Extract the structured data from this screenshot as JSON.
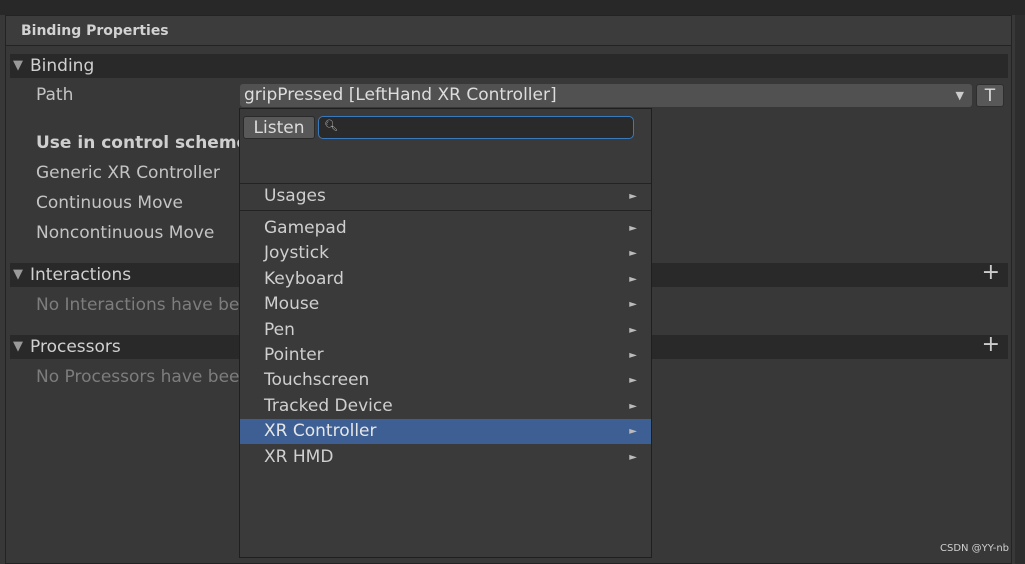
{
  "header": {
    "title": "Binding Properties"
  },
  "binding": {
    "title": "Binding",
    "path_label": "Path",
    "path_value": "gripPressed [LeftHand XR Controller]",
    "t_button": "T",
    "schemes_label": "Use in control scheme",
    "schemes": [
      "Generic XR Controller",
      "Continuous Move",
      "Noncontinuous Move"
    ]
  },
  "interactions": {
    "title": "Interactions",
    "empty": "No Interactions have been added."
  },
  "processors": {
    "title": "Processors",
    "empty": "No Processors have been added."
  },
  "popup": {
    "listen": "Listen",
    "search_value": "",
    "usages": "Usages",
    "items": [
      "Gamepad",
      "Joystick",
      "Keyboard",
      "Mouse",
      "Pen",
      "Pointer",
      "Touchscreen",
      "Tracked Device",
      "XR Controller",
      "XR HMD"
    ],
    "selected": "XR Controller",
    "submenu_glyph": "►"
  },
  "colors": {
    "selection": "#3d5f94",
    "focus": "#3a79bb"
  },
  "watermark": "CSDN @YY-nb"
}
